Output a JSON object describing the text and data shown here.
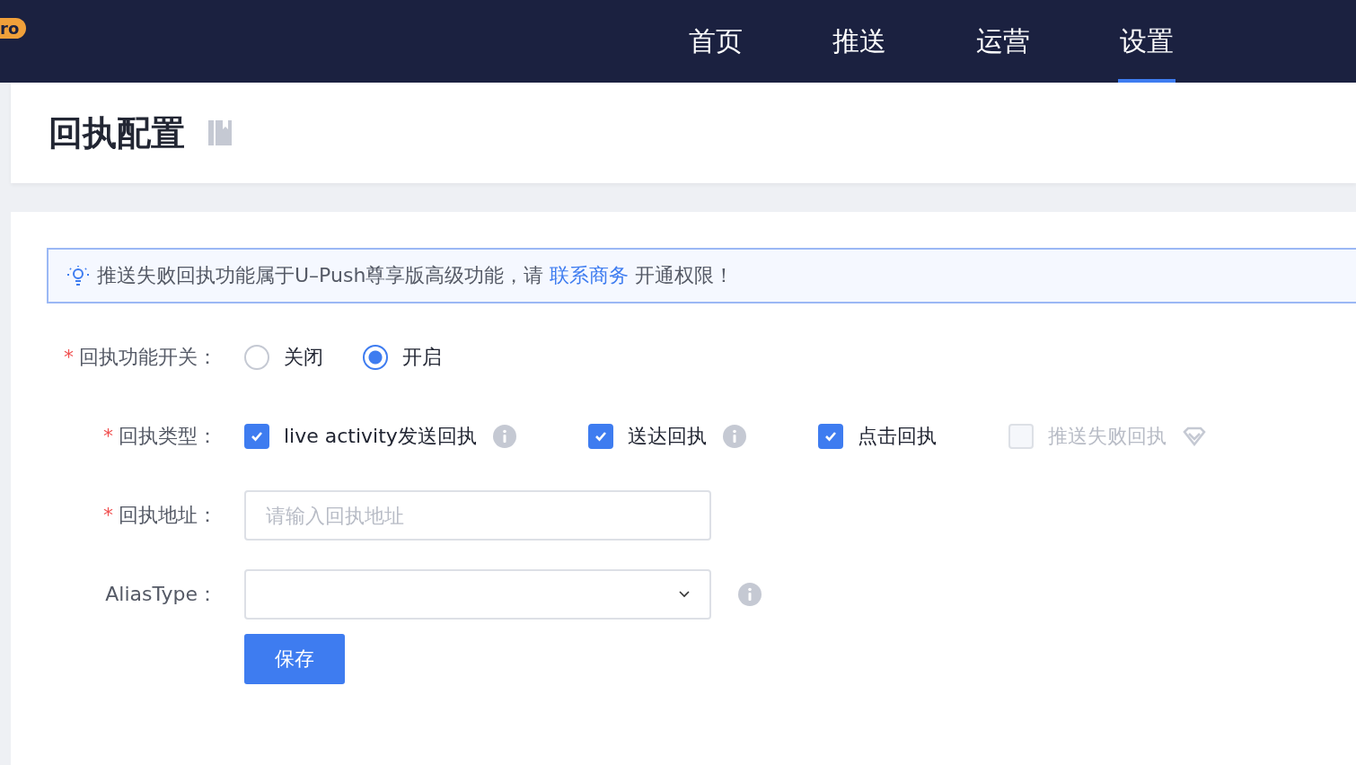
{
  "header": {
    "badge": "ro",
    "nav": [
      {
        "label": "首页",
        "selected": false
      },
      {
        "label": "推送",
        "selected": false
      },
      {
        "label": "运营",
        "selected": false
      },
      {
        "label": "设置",
        "selected": true
      }
    ]
  },
  "page_title": "回执配置",
  "notice": {
    "text_before": "推送失败回执功能属于U–Push尊享版高级功能，请",
    "link": "联系商务",
    "text_after": "开通权限！"
  },
  "form": {
    "switch": {
      "label": "回执功能开关：",
      "required_mark": "*",
      "options": [
        {
          "label": "关闭",
          "selected": false
        },
        {
          "label": "开启",
          "selected": true
        }
      ]
    },
    "types": {
      "label": "回执类型：",
      "required_mark": "*",
      "options": [
        {
          "label": "live activity发送回执",
          "checked": true,
          "disabled": false,
          "kind": "info"
        },
        {
          "label": "送达回执",
          "checked": true,
          "disabled": false,
          "kind": "info"
        },
        {
          "label": "点击回执",
          "checked": true,
          "disabled": false,
          "kind": "plain"
        },
        {
          "label": "推送失败回执",
          "checked": false,
          "disabled": true,
          "kind": "premium"
        }
      ]
    },
    "address": {
      "label": "回执地址：",
      "required_mark": "*",
      "placeholder": "请输入回执地址"
    },
    "alias_type": {
      "label": "AliasType："
    },
    "save_button": "保存"
  }
}
